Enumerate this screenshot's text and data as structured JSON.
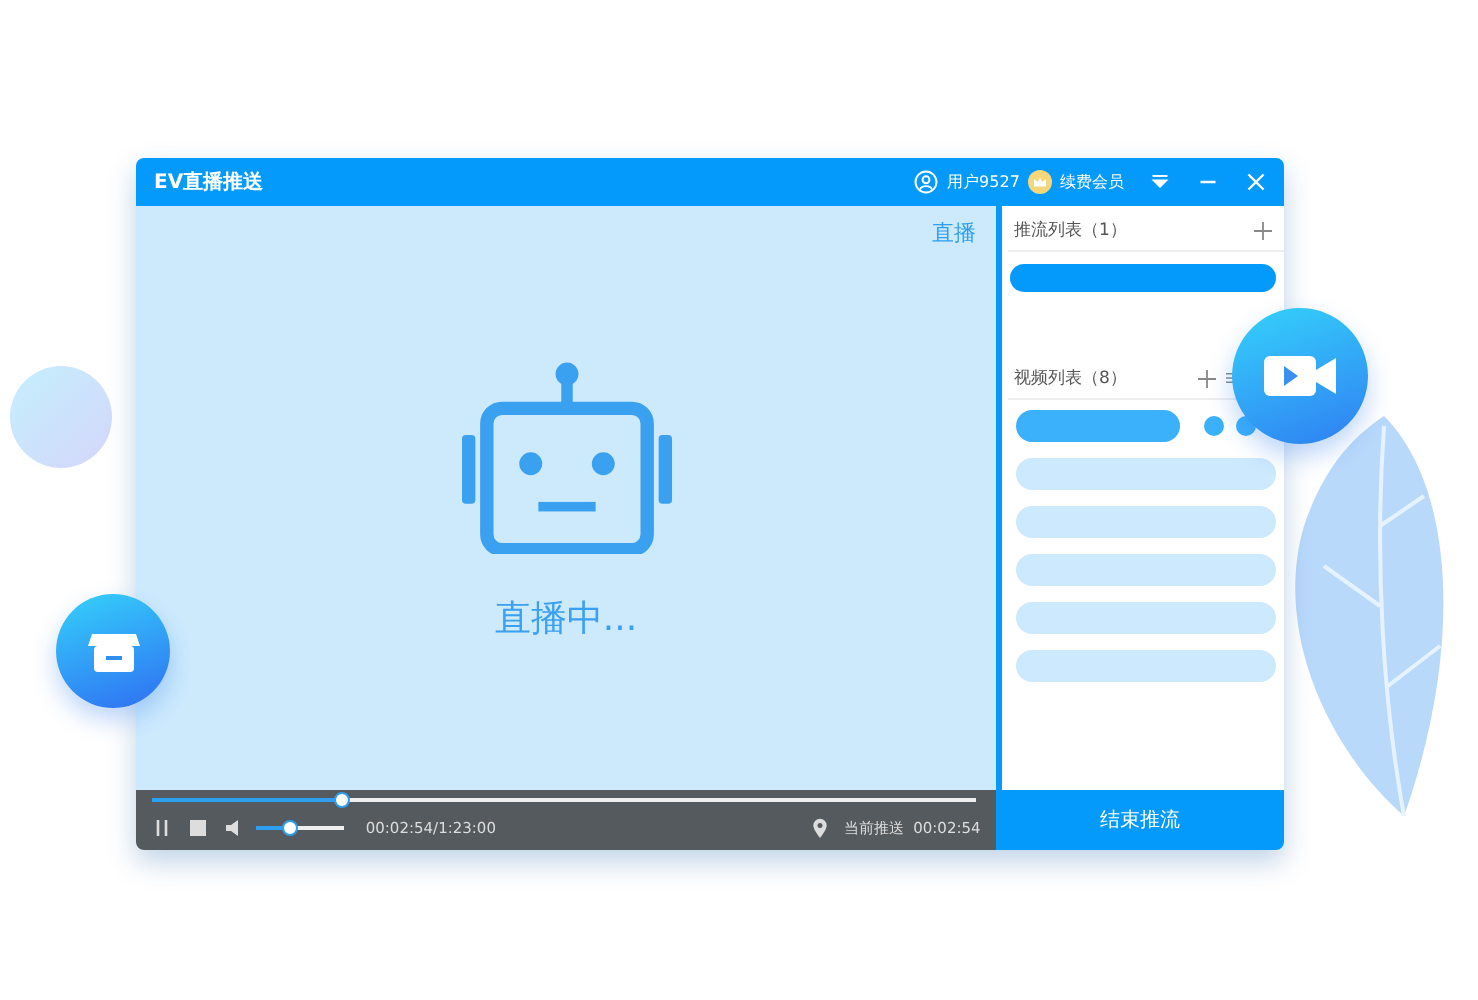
{
  "window": {
    "title": "EV直播推送"
  },
  "account": {
    "user": "用户9527",
    "vip": "续费会员"
  },
  "video": {
    "tag": "直播",
    "status": "直播中...",
    "progress": {
      "level": 0.23
    },
    "volume": {
      "level": 0.38
    },
    "time": "00:02:54/1:23:00",
    "location_label": "当前推送",
    "location_time": "00:02:54"
  },
  "push_list": {
    "title": "推流列表（1）",
    "rows": [
      {
        "selected": true
      }
    ]
  },
  "video_list": {
    "title": "视频列表（8）",
    "rows": [
      {
        "selected": true
      },
      {
        "selected": false
      },
      {
        "selected": false
      },
      {
        "selected": false
      },
      {
        "selected": false
      },
      {
        "selected": false
      }
    ]
  },
  "end_button": "结束推流"
}
